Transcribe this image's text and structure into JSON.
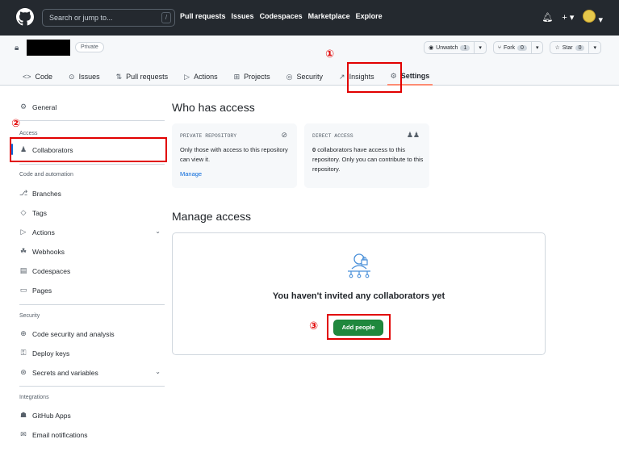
{
  "topbar": {
    "search_placeholder": "Search or jump to...",
    "slash_key": "/",
    "nav": [
      "Pull requests",
      "Issues",
      "Codespaces",
      "Marketplace",
      "Explore"
    ],
    "bell_icon": "bell-icon",
    "plus_icon": "plus-icon"
  },
  "repo": {
    "visibility": "Private",
    "watch": {
      "label": "Unwatch",
      "count": "1"
    },
    "fork": {
      "label": "Fork",
      "count": "0"
    },
    "star": {
      "label": "Star",
      "count": "0"
    },
    "tabs": [
      "Code",
      "Issues",
      "Pull requests",
      "Actions",
      "Projects",
      "Security",
      "Insights",
      "Settings"
    ],
    "active_tab": "Settings"
  },
  "sidebar": {
    "general": "General",
    "access_heading": "Access",
    "collaborators": "Collaborators",
    "code_heading": "Code and automation",
    "branches": "Branches",
    "tags": "Tags",
    "actions": "Actions",
    "webhooks": "Webhooks",
    "codespaces": "Codespaces",
    "pages": "Pages",
    "security_heading": "Security",
    "code_security": "Code security and analysis",
    "deploy_keys": "Deploy keys",
    "secrets": "Secrets and variables",
    "integrations_heading": "Integrations",
    "github_apps": "GitHub Apps",
    "email_notifications": "Email notifications"
  },
  "main": {
    "who_heading": "Who has access",
    "private_card": {
      "label": "PRIVATE REPOSITORY",
      "desc": "Only those with access to this repository can view it.",
      "link": "Manage"
    },
    "direct_card": {
      "label": "DIRECT ACCESS",
      "count": "0",
      "desc": " collaborators have access to this repository. Only you can contribute to this repository."
    },
    "manage_heading": "Manage access",
    "empty_title": "You haven't invited any collaborators yet",
    "add_button": "Add people"
  },
  "annotations": {
    "step1": "①",
    "step2": "②",
    "step3": "③",
    "color": "#e10000"
  },
  "colors": {
    "topbar": "#24292f",
    "accent": "#0969da",
    "primary_button": "#1f883d",
    "tab_underline": "#fd8c73"
  }
}
